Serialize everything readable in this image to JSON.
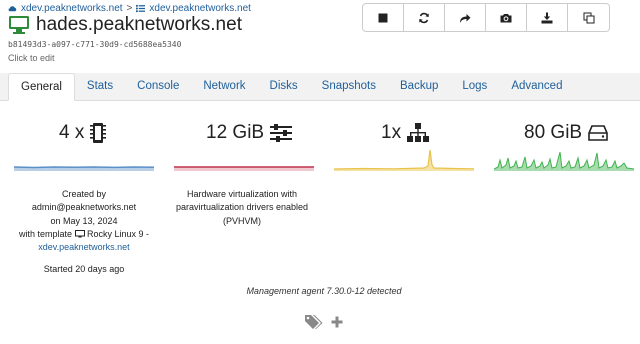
{
  "breadcrumb": {
    "pool": "xdev.peaknetworks.net",
    "host": "xdev.peaknetworks.net"
  },
  "vm": {
    "name": "hades.peaknetworks.net",
    "uuid": "b81493d3-a097-c771-30d9-cd5688ea5340",
    "edit_hint": "Click to edit"
  },
  "toolbar": {
    "buttons": [
      "stop-icon",
      "restart-icon",
      "migrate-icon",
      "snapshot-icon",
      "export-icon",
      "copy-icon"
    ]
  },
  "tabs": [
    "General",
    "Stats",
    "Console",
    "Network",
    "Disks",
    "Snapshots",
    "Backup",
    "Logs",
    "Advanced"
  ],
  "active_tab": "General",
  "stats": {
    "cpu": {
      "value": "4 x",
      "icon": "cpu-icon",
      "color": "#5b8fc7"
    },
    "memory": {
      "value": "12 GiB",
      "icon": "sliders-icon",
      "color": "#c0304a"
    },
    "network": {
      "value": "1x",
      "icon": "network-icon",
      "color": "#e8c24a"
    },
    "disk": {
      "value": "80 GiB",
      "icon": "hdd-icon",
      "color": "#3fb34f"
    }
  },
  "created": {
    "label": "Created by",
    "by": "admin@peaknetworks.net",
    "date": "on May 13, 2024",
    "template_prefix": "with template",
    "template": "Rocky Linux 9 -",
    "template_host": "xdev.peaknetworks.net",
    "started": "Started 20 days ago"
  },
  "virtualization": "Hardware virtualization with paravirtualization drivers enabled (PVHVM)",
  "agent": "Management agent 7.30.0-12 detected"
}
